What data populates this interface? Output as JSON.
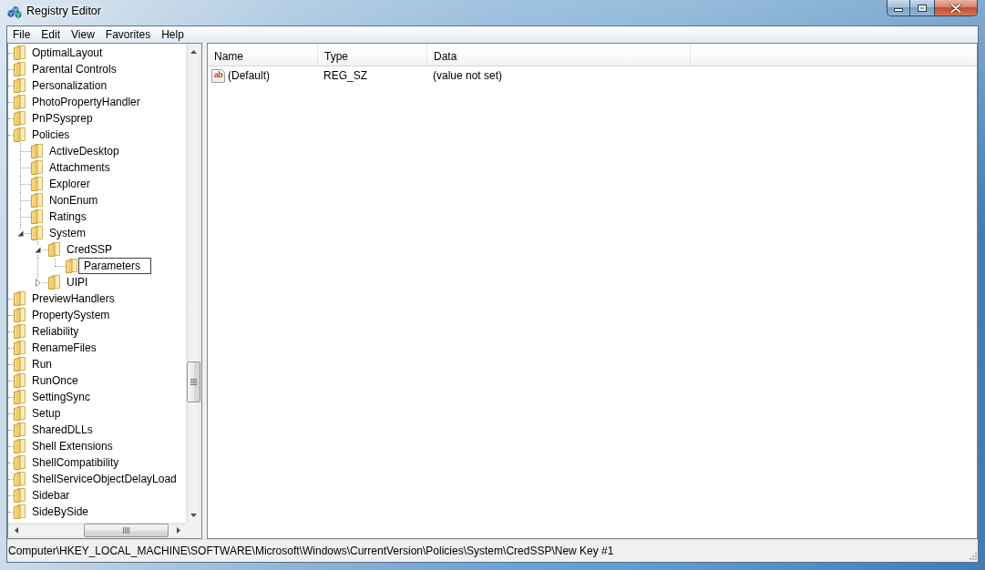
{
  "window": {
    "title": "Registry Editor"
  },
  "menu": [
    "File",
    "Edit",
    "View",
    "Favorites",
    "Help"
  ],
  "tree": {
    "items": [
      {
        "label": "OptimalLayout"
      },
      {
        "label": "Parental Controls"
      },
      {
        "label": "Personalization"
      },
      {
        "label": "PhotoPropertyHandler"
      },
      {
        "label": "PnPSysprep"
      },
      {
        "label": "Policies",
        "children": [
          {
            "label": "ActiveDesktop"
          },
          {
            "label": "Attachments"
          },
          {
            "label": "Explorer"
          },
          {
            "label": "NonEnum"
          },
          {
            "label": "Ratings"
          },
          {
            "label": "System",
            "expanded": true,
            "children": [
              {
                "label": "CredSSP",
                "expanded": true,
                "children": [
                  {
                    "label": "Parameters",
                    "renaming": true
                  }
                ]
              },
              {
                "label": "UIPI",
                "expanded": false
              }
            ]
          }
        ]
      },
      {
        "label": "PreviewHandlers"
      },
      {
        "label": "PropertySystem"
      },
      {
        "label": "Reliability"
      },
      {
        "label": "RenameFiles"
      },
      {
        "label": "Run"
      },
      {
        "label": "RunOnce"
      },
      {
        "label": "SettingSync"
      },
      {
        "label": "Setup"
      },
      {
        "label": "SharedDLLs"
      },
      {
        "label": "Shell Extensions"
      },
      {
        "label": "ShellCompatibility"
      },
      {
        "label": "ShellServiceObjectDelayLoad"
      },
      {
        "label": "Sidebar"
      },
      {
        "label": "SideBySide"
      }
    ]
  },
  "values": {
    "columns": [
      "Name",
      "Type",
      "Data"
    ],
    "rows": [
      {
        "icon_label": "ab",
        "name": "(Default)",
        "type": "REG_SZ",
        "data": "(value not set)"
      }
    ]
  },
  "status_bar": {
    "path": "Computer\\HKEY_LOCAL_MACHINE\\SOFTWARE\\Microsoft\\Windows\\CurrentVersion\\Policies\\System\\CredSSP\\New Key #1"
  }
}
